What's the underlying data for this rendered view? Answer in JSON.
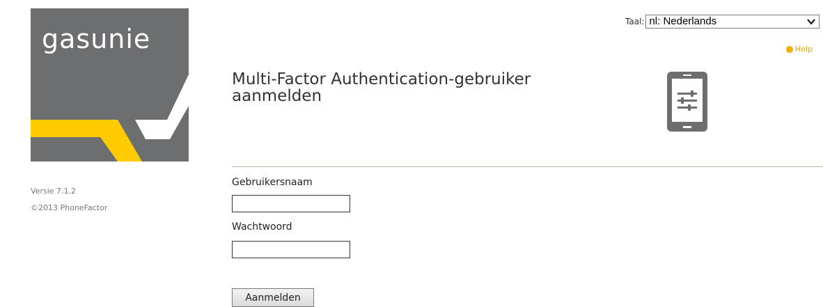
{
  "logo": {
    "text": "gasunie",
    "bg_color": "#6d6e70",
    "accent_color": "#ffcc00"
  },
  "sidebar": {
    "version": "Versie 7.1.2",
    "copyright": "©2013 PhoneFactor"
  },
  "header": {
    "language_label": "Taal:",
    "language_selected": "nl: Nederlands",
    "help_label": "Help",
    "help_color": "#e8a200"
  },
  "main": {
    "title": "Multi-Factor Authentication-gebruiker aanmelden",
    "icon": "phone-settings-icon",
    "username_label": "Gebruikersnaam",
    "username_value": "",
    "password_label": "Wachtwoord",
    "password_value": "",
    "submit_label": "Aanmelden"
  }
}
